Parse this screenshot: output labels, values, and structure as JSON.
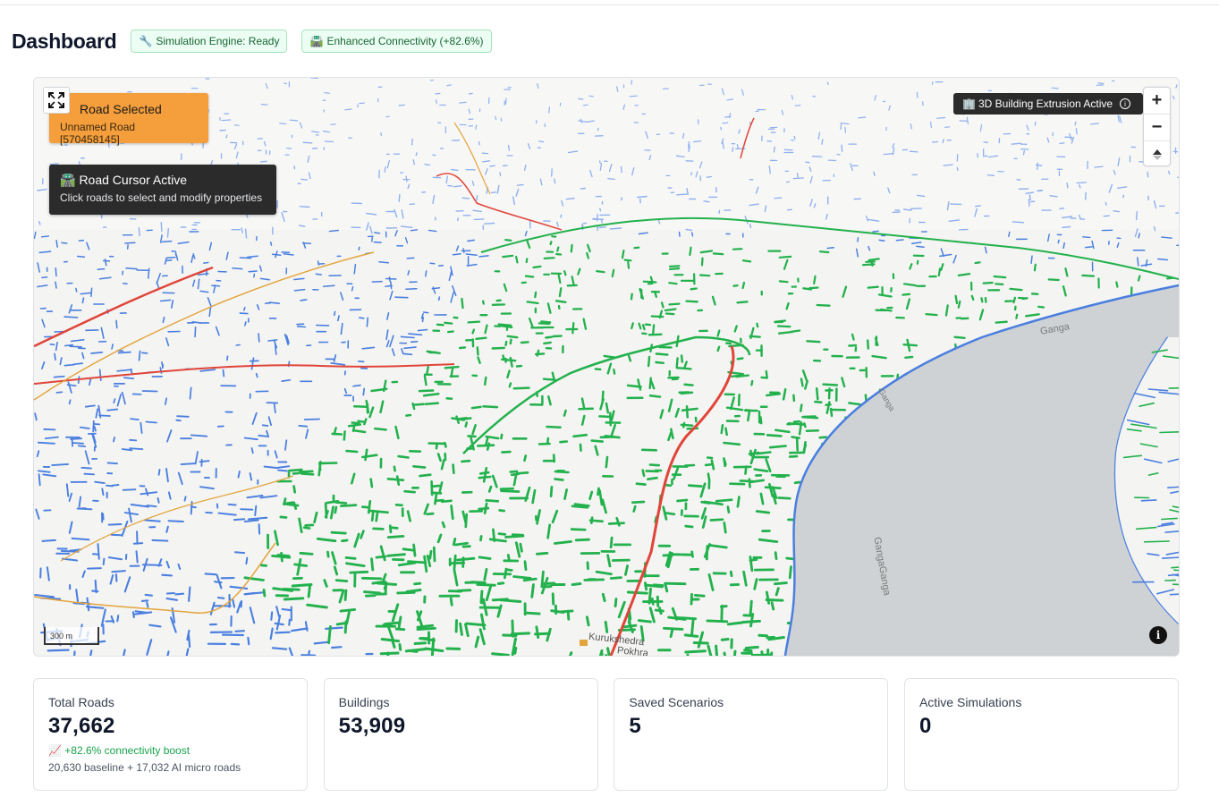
{
  "header": {
    "title": "Dashboard",
    "badges": [
      {
        "icon": "🔧",
        "label": "Simulation Engine: Ready"
      },
      {
        "icon": "🛣️",
        "label": "Enhanced Connectivity (+82.6%)"
      }
    ]
  },
  "map": {
    "selected_road": {
      "icon": "🛣️",
      "title": "Road Selected",
      "subtitle": "Unnamed Road [570458145]"
    },
    "cursor_hint": {
      "icon": "🛣️",
      "title": "Road Cursor Active",
      "subtitle": "Click roads to select and modify properties"
    },
    "extrusion": {
      "icon": "🏢",
      "label": "3D Building Extrusion Active",
      "info": "i"
    },
    "zoom": {
      "in": "+",
      "out": "−",
      "compass": "▲"
    },
    "scale_label": "300 m",
    "attribution_icon": "i",
    "labels": {
      "river_1": "Ganga",
      "river_2": "Ganga",
      "river_3": "GangaGanga",
      "place_1": "Kurukshedra",
      "place_2": "Pokhra"
    },
    "colors": {
      "ai_roads": "#22b14c",
      "baseline_roads": "#4a7fe0",
      "arterial": "#e0453a",
      "secondary": "#e3a43c",
      "water": "#cfd2d4"
    }
  },
  "stats": [
    {
      "label": "Total Roads",
      "value": "37,662",
      "trend_icon": "📈",
      "trend": "+82.6% connectivity boost",
      "sub": "20,630 baseline + 17,032 AI micro roads"
    },
    {
      "label": "Buildings",
      "value": "53,909"
    },
    {
      "label": "Saved Scenarios",
      "value": "5"
    },
    {
      "label": "Active Simulations",
      "value": "0"
    }
  ]
}
